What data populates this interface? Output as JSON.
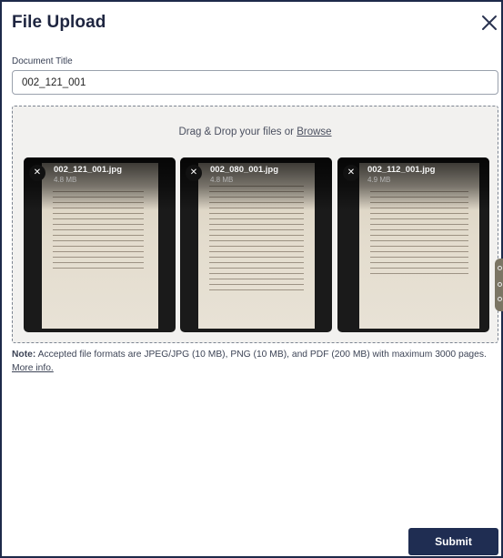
{
  "dialog": {
    "title": "File Upload",
    "close_icon": "close-icon"
  },
  "document_title": {
    "label": "Document Title",
    "value": "002_121_001"
  },
  "dropzone": {
    "text_prefix": "Drag & Drop your files or ",
    "browse_label": "Browse"
  },
  "files": [
    {
      "name": "002_121_001.jpg",
      "size": "4.8 MB"
    },
    {
      "name": "002_080_001.jpg",
      "size": "4.8 MB"
    },
    {
      "name": "002_112_001.jpg",
      "size": "4.9 MB"
    }
  ],
  "note": {
    "label": "Note:",
    "text": " Accepted file formats are JPEG/JPG (10 MB), PNG (10 MB), and PDF (200 MB) with maximum 3000 pages.",
    "more_info": "More info."
  },
  "submit_label": "Submit"
}
